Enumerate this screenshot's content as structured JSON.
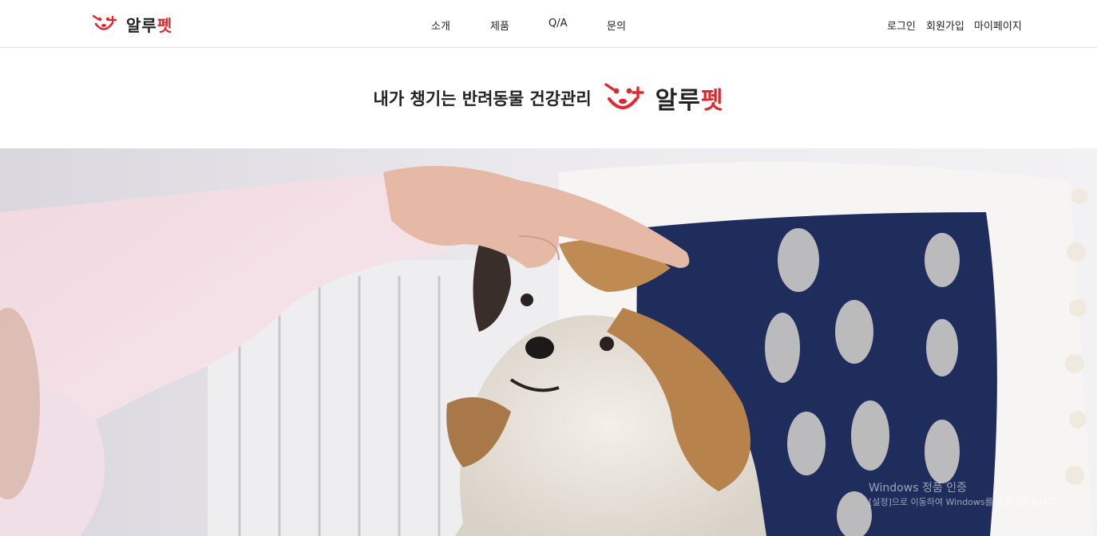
{
  "header": {
    "logo": {
      "part1": "알루",
      "part2": "펫"
    },
    "nav": [
      "소개",
      "제품",
      "Q/A",
      "문의"
    ],
    "util": [
      "로그인",
      "회원가입",
      "마이페이지"
    ]
  },
  "hero": {
    "tagline": "내가 챙기는 반려동물 건강관리",
    "brand_part1": "알루",
    "brand_part2": "펫"
  },
  "watermark": {
    "title": "Windows 정품 인증",
    "subtitle": "[설정]으로 이동하여 Windows를 정품 인증합니다."
  },
  "colors": {
    "brand_red": "#e0282e",
    "text": "#222222",
    "pillow_navy": "#1f2d5c"
  },
  "icons": {
    "logo": "paw-face-plus-icon"
  }
}
